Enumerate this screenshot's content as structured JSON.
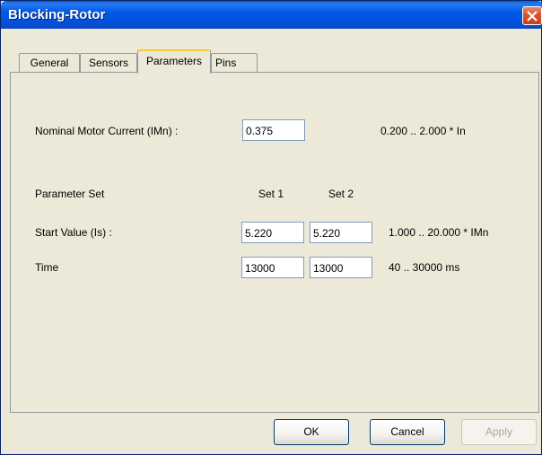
{
  "window": {
    "title": "Blocking-Rotor"
  },
  "tabs": [
    {
      "label": "General"
    },
    {
      "label": "Sensors"
    },
    {
      "label": "Parameters",
      "active": true
    },
    {
      "label": "Pins"
    }
  ],
  "nominal": {
    "label": "Nominal Motor Current (IMn) :",
    "value": "0.375",
    "range": "0.200 .. 2.000 * In"
  },
  "param_set": {
    "label": "Parameter Set",
    "set1": "Set 1",
    "set2": "Set 2"
  },
  "start_value": {
    "label": "Start Value (Is) :",
    "set1": "5.220",
    "set2": "5.220",
    "range": "1.000 .. 20.000 * IMn"
  },
  "time": {
    "label": "Time",
    "set1": "13000",
    "set2": "13000",
    "range": "40 .. 30000 ms"
  },
  "buttons": {
    "ok": "OK",
    "cancel": "Cancel",
    "apply": "Apply"
  },
  "icons": {
    "close": "close-icon"
  }
}
